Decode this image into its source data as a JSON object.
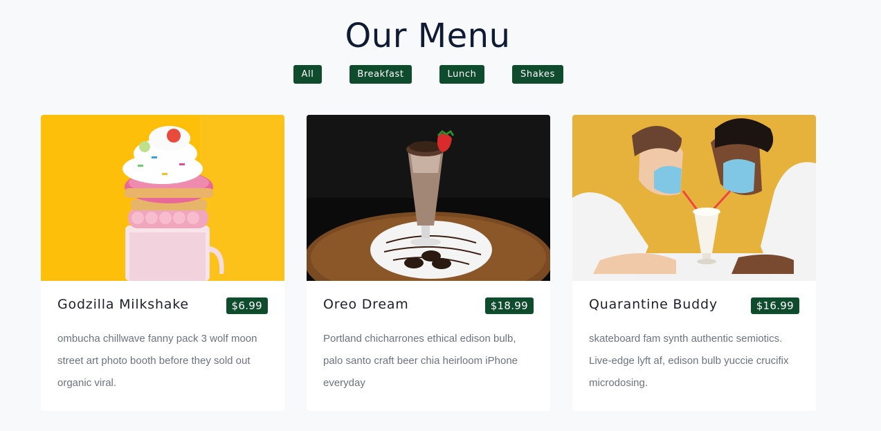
{
  "page_title": "Our Menu",
  "filters": [
    "All",
    "Breakfast",
    "Lunch",
    "Shakes"
  ],
  "colors": {
    "accent": "#0f4c2d",
    "background": "#f8f9fb",
    "title": "#0f1a33"
  },
  "items": [
    {
      "title": "Godzilla Milkshake",
      "price": "$6.99",
      "description": "ombucha chillwave fanny pack 3 wolf moon street art photo booth before they sold out organic viral.",
      "image": "freakshake-photo"
    },
    {
      "title": "Oreo Dream",
      "price": "$18.99",
      "description": "Portland chicharrones ethical edison bulb, palo santo craft beer chia heirloom iPhone everyday",
      "image": "oreo-shake-photo"
    },
    {
      "title": "Quarantine Buddy",
      "price": "$16.99",
      "description": "skateboard fam synth authentic semiotics. Live-edge lyft af, edison bulb yuccie crucifix microdosing.",
      "image": "couple-masks-shake-photo"
    }
  ]
}
